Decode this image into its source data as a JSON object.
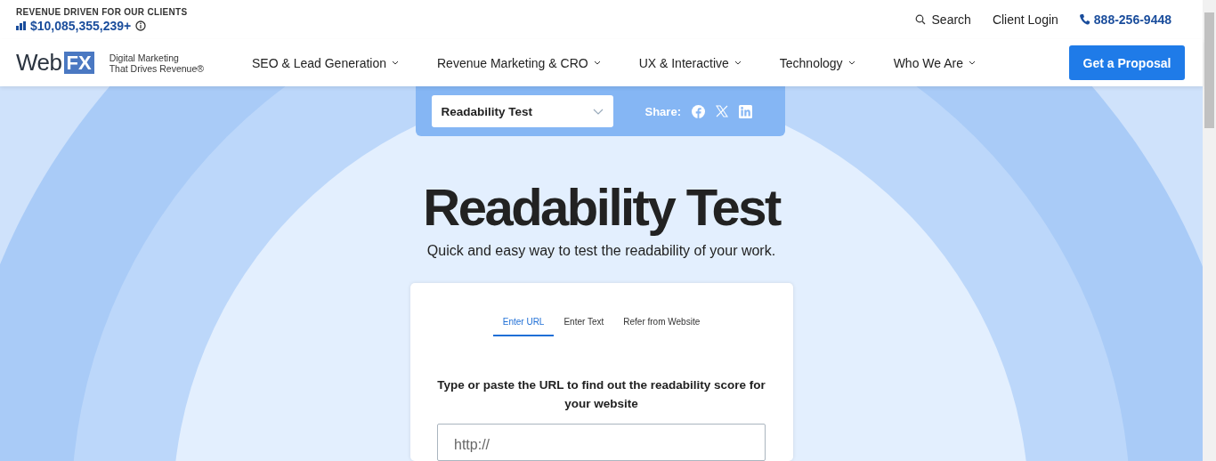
{
  "topbar": {
    "revenue_label": "REVENUE DRIVEN FOR OUR CLIENTS",
    "revenue_value": "$10,085,355,239+",
    "search": "Search",
    "client_login": "Client Login",
    "phone": "888-256-9448"
  },
  "logo": {
    "word": "Web",
    "mark": "FX",
    "tagline_1": "Digital Marketing",
    "tagline_2": "That Drives Revenue®"
  },
  "nav": [
    {
      "label": "SEO & Lead Generation"
    },
    {
      "label": "Revenue Marketing & CRO"
    },
    {
      "label": "UX & Interactive"
    },
    {
      "label": "Technology"
    },
    {
      "label": "Who We Are"
    }
  ],
  "cta": "Get a Proposal",
  "tool_bar": {
    "dropdown": "Readability Test",
    "share_label": "Share:"
  },
  "hero": {
    "title": "Readability Test",
    "subtitle": "Quick and easy way to test the readability of your work."
  },
  "tabs": [
    {
      "label": "Enter URL",
      "selected": true
    },
    {
      "label": "Enter Text",
      "selected": false
    },
    {
      "label": "Refer from Website",
      "selected": false
    }
  ],
  "form": {
    "prompt": "Type or paste the URL to find out the readability score for your website",
    "placeholder": "http://"
  }
}
